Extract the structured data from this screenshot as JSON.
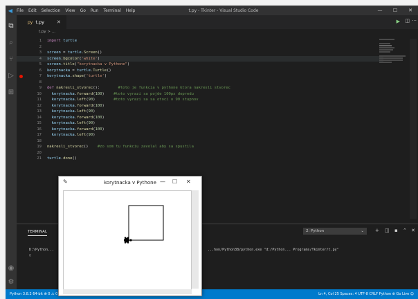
{
  "window": {
    "logo": "◀",
    "menu": [
      "File",
      "Edit",
      "Selection",
      "View",
      "Go",
      "Run",
      "Terminal",
      "Help"
    ],
    "title": "t.py - Tkinter - Visual Studio Code",
    "min": "—",
    "max": "☐",
    "close": "✕"
  },
  "tab": {
    "icon": "py",
    "name": "t.py",
    "close": "✕"
  },
  "breadcrumb": "t.py > ...",
  "icons": {
    "explorer": "⧉",
    "search": "⌕",
    "scm": "⑂",
    "debug": "▷",
    "extensions": "⊞",
    "account": "◉",
    "settings": "⚙",
    "run": "▶",
    "split": "◫",
    "more": "···"
  },
  "code_lines": [
    {
      "num": "1",
      "text": "import turtle"
    },
    {
      "num": "2",
      "text": ""
    },
    {
      "num": "3",
      "text": "screen = turtle.Screen()"
    },
    {
      "num": "4",
      "text": "screen.bgcolor('white')"
    },
    {
      "num": "5",
      "text": "screen.title(\"korytnacka v Pythone\")"
    },
    {
      "num": "6",
      "text": "korytnacka = turtle.Turtle()"
    },
    {
      "num": "7",
      "text": "korytnacka.shape('turtle')"
    },
    {
      "num": "8",
      "text": ""
    },
    {
      "num": "9",
      "text": "def nakresli_stvorec():        #toto je funkcia v pythone ktora nakresli stvorec"
    },
    {
      "num": "10",
      "text": "  korytnacka.forward(100)    #toto vyrazi sa pojde 100px dopredu"
    },
    {
      "num": "11",
      "text": "  korytnacka.left(90)        #toto vyrazi sa sa otoci o 90 stupnov"
    },
    {
      "num": "12",
      "text": "  korytnacka.forward(100)"
    },
    {
      "num": "13",
      "text": "  korytnacka.left(90)"
    },
    {
      "num": "14",
      "text": "  korytnacka.forward(100)"
    },
    {
      "num": "15",
      "text": "  korytnacka.left(90)"
    },
    {
      "num": "16",
      "text": "  korytnacka.forward(100)"
    },
    {
      "num": "17",
      "text": "  korytnacka.left(90)"
    },
    {
      "num": "18",
      "text": ""
    },
    {
      "num": "19",
      "text": "nakresli_stvorec()    #zo som tu funkciu zavolal aby sa spustila"
    },
    {
      "num": "20",
      "text": ""
    },
    {
      "num": "21",
      "text": "turtle.done()"
    }
  ],
  "panel": {
    "tab": "TERMINAL",
    "select": "2: Python",
    "select_arrow": "⌄",
    "terminal_line1_left": "D:\\Python...",
    "terminal_line1_right": "...hon/Python38/python.exe \"d:/Python... Programs/Tkinter/t.py\"",
    "terminal_line2": "▯",
    "plus": "+",
    "split": "◫",
    "trash": "▪",
    "up": "⌃",
    "close": "✕"
  },
  "turtle_window": {
    "title": "korytnacka v Pythone",
    "feather": "✎",
    "min": "—",
    "max": "☐",
    "close": "✕"
  },
  "status": {
    "left": "Python 3.8.2 64-bit    ⊗ 0 ⚠ 0",
    "right": "Ln 4, Col 25   Spaces: 4   UTF-8   CRLF   Python   ⊕ Go Live   ☺"
  },
  "colors": {
    "keyword": "#c586c0",
    "function": "#dcdcaa",
    "string": "#ce9178",
    "number": "#b5cea8",
    "comment": "#6a9955",
    "variable": "#9cdcfe"
  }
}
